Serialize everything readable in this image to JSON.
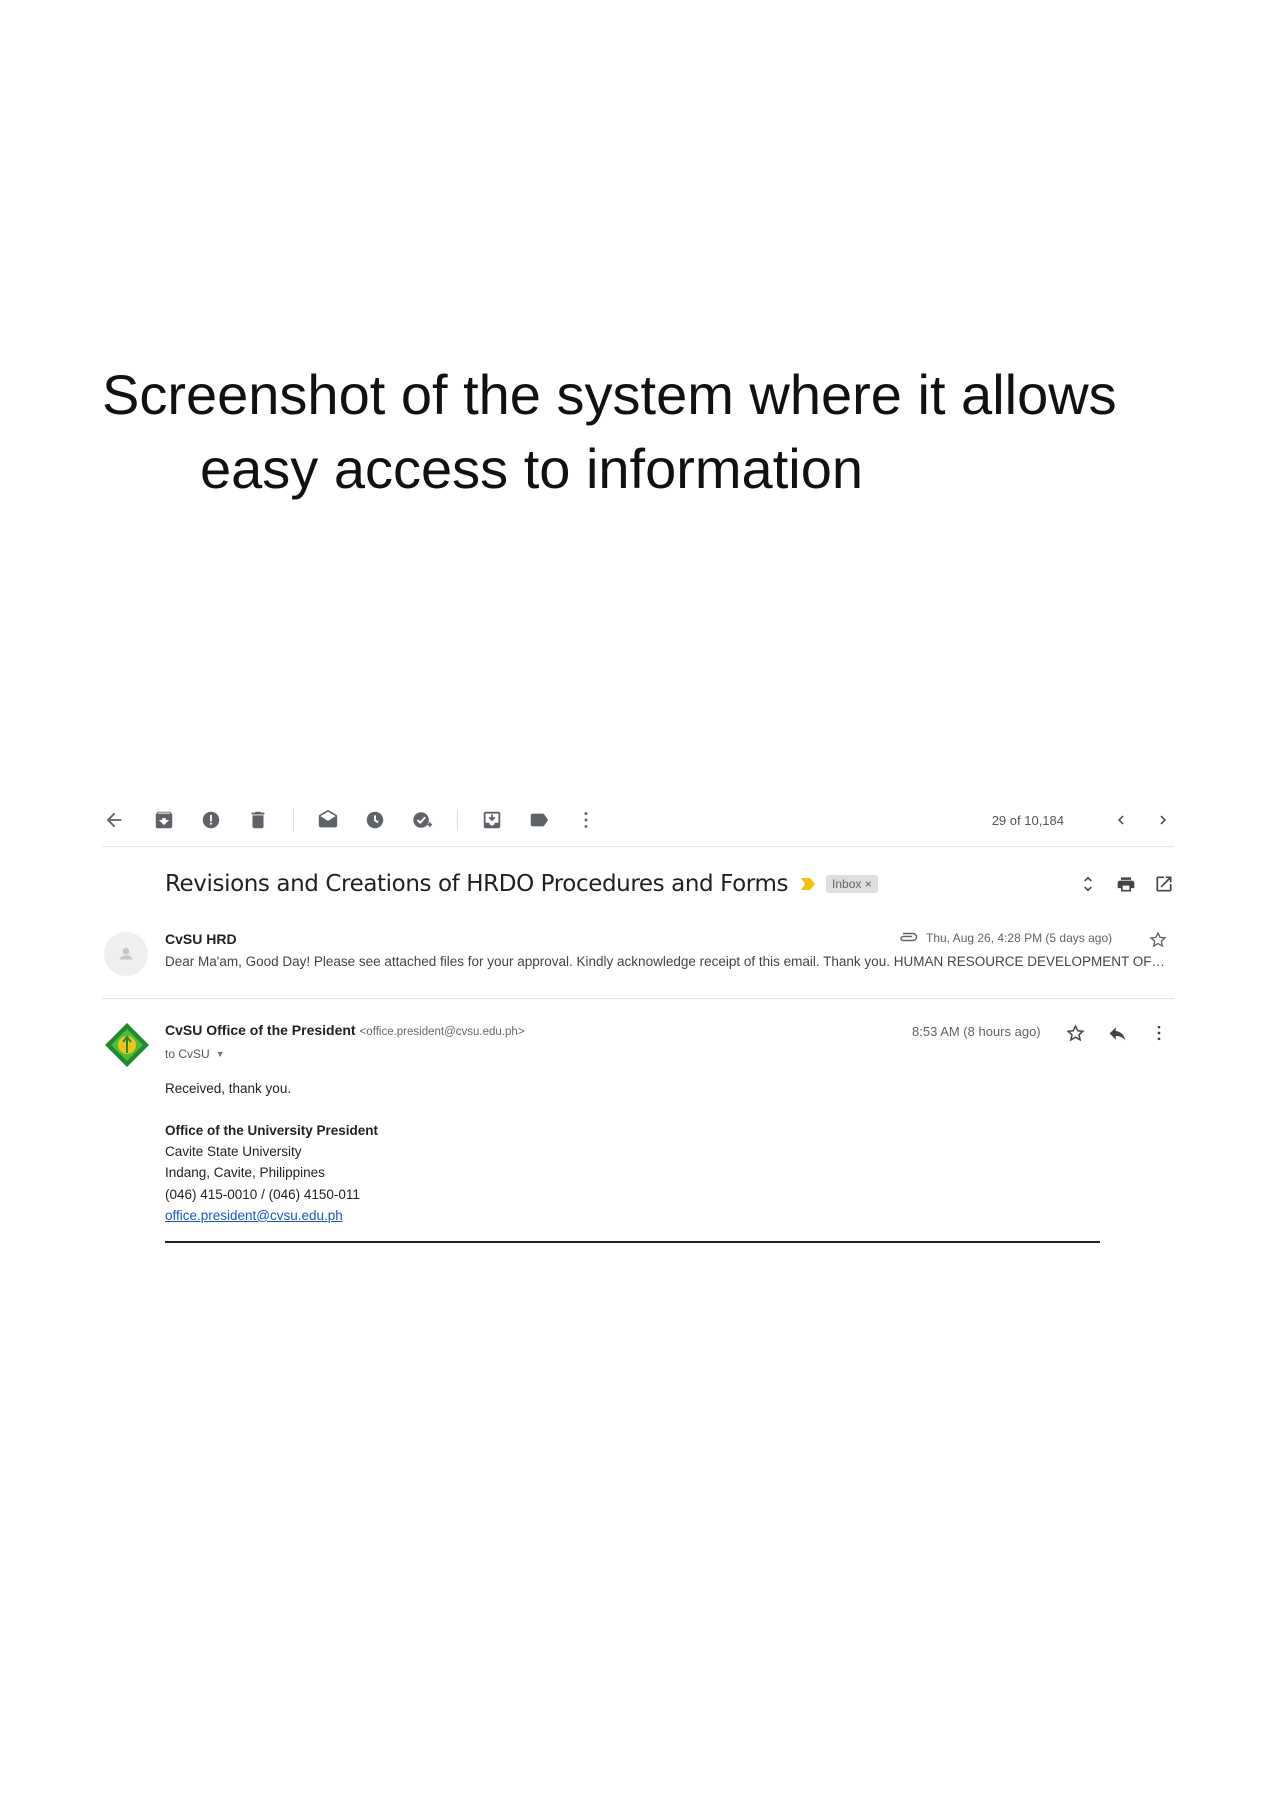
{
  "caption": {
    "line1": "Screenshot of the system where it allows",
    "line2": "easy access to information"
  },
  "toolbar": {
    "icons": [
      "back-arrow-icon",
      "archive-icon",
      "report-spam-icon",
      "delete-icon",
      "mark-unread-icon",
      "snooze-icon",
      "add-task-icon",
      "move-to-icon",
      "label-icon",
      "more-vert-icon"
    ],
    "counter": "29 of 10,184"
  },
  "thread": {
    "subject": "Revisions and Creations of HRDO Procedures and Forms",
    "label_chip": "Inbox ×",
    "important_color": "#f4c20d"
  },
  "message1": {
    "sender": "CvSU HRD",
    "date": "Thu, Aug 26, 4:28 PM (5 days ago)",
    "snippet": "Dear Ma'am, Good Day! Please see attached files for your approval. Kindly acknowledge receipt of this email. Thank you. HUMAN RESOURCE DEVELOPMENT OFFICE"
  },
  "message2": {
    "sender_name": "CvSU Office of the President",
    "sender_email": "<office.president@cvsu.edu.ph>",
    "to": "to CvSU",
    "time": "8:53 AM (8 hours ago)",
    "body": "Received, thank you.",
    "signature": {
      "org": "Office of the University President",
      "university": "Cavite State University",
      "address": "Indang, Cavite, Philippines",
      "phone": "(046) 415-0010 / (046) 4150-011",
      "email": "office.president@cvsu.edu.ph"
    },
    "logo_colors": {
      "outer": "#1f8a2c",
      "inner": "#4dbb3c",
      "accent": "#f2c418"
    }
  }
}
